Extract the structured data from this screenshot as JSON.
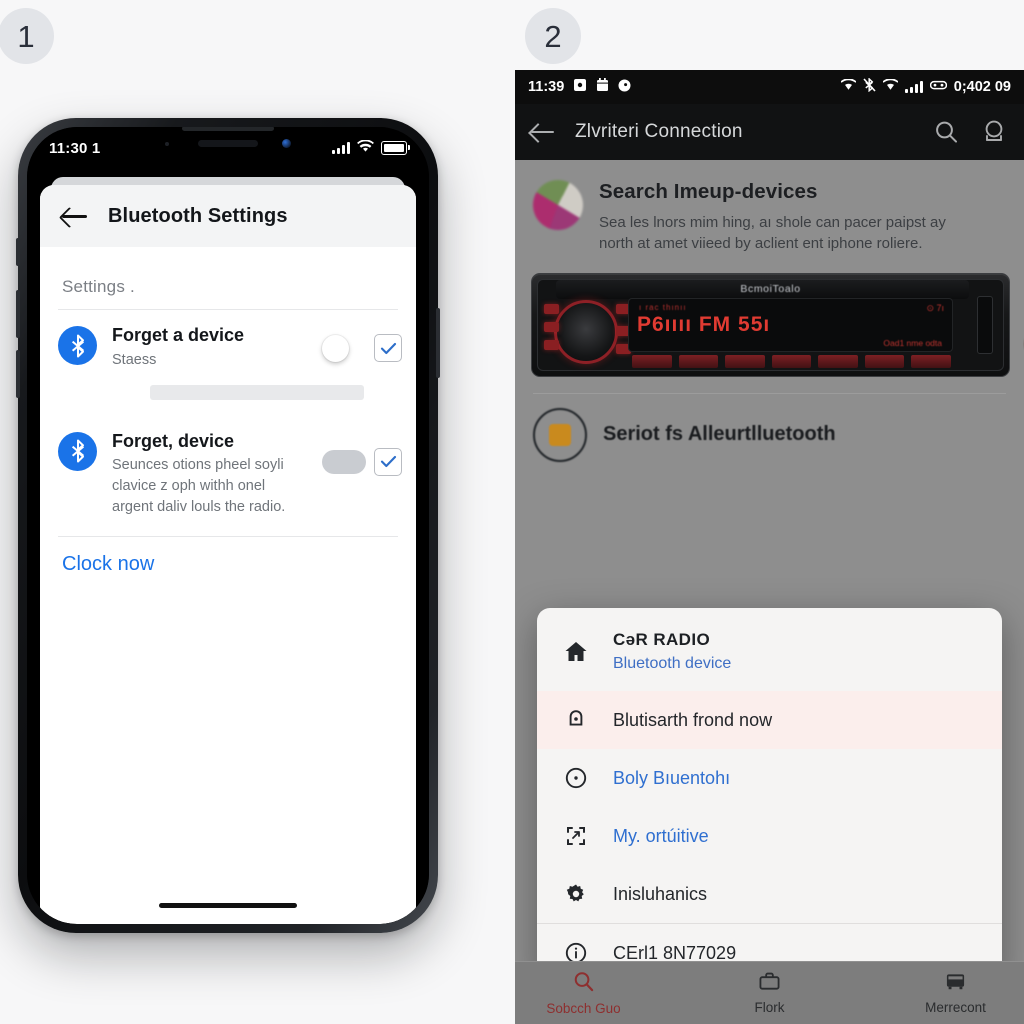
{
  "steps": {
    "one": "1",
    "two": "2"
  },
  "left_phone": {
    "status_bar": {
      "time": "11:30 1",
      "signal_icon": "signal-bars-icon",
      "wifi_icon": "wifi-icon",
      "battery_icon": "battery-icon"
    },
    "app_bar": {
      "back_icon": "back-arrow-icon",
      "title": "Bluetooth Settings"
    },
    "section_label": "Settings .",
    "rows": [
      {
        "icon": "bluetooth-icon",
        "title": "Forget a device",
        "subtitle": "Staess",
        "toggle_state": "off",
        "checkbox_state": "checked"
      },
      {
        "icon": "bluetooth-icon",
        "title": "Forget, device",
        "subtitle": "Seunces otions pheel soyli clavice z oph withh onel argent daliv louls the radio.",
        "toggle_state": "grey",
        "checkbox_state": "checked"
      }
    ],
    "link": "Clock now",
    "home_indicator": "home-indicator"
  },
  "right_phone": {
    "status_bar": {
      "time": "11:39",
      "left_icons": [
        "sim-icon",
        "calendar-icon",
        "record-icon"
      ],
      "right_icons": [
        "wifi-icon",
        "bluetooth-off-icon",
        "wifi-icon",
        "signal-bars-icon",
        "vr-icon"
      ],
      "right_text": "0;402 09"
    },
    "app_bar": {
      "back_icon": "back-arrow-icon",
      "title": "Zlvriteri Connection",
      "search_icon": "search-icon",
      "profile_icon": "account-icon"
    },
    "content": {
      "avatar_icon": "globe-avatar-icon",
      "heading": "Search Imeup-devices",
      "body": "Sea les lnors mim hing, aı shole can pacer paipst ay north at amet viieed by aclient ent iphone roliere.",
      "radio_image": {
        "brand": "BcmoiToalo",
        "lcd_line1": "ı rac  thınıı",
        "lcd_line2": "P6ıııı  FM 55ı",
        "lcd_line3": "Oad1 nme  odta",
        "lcd_line4": "⊙ 7ı",
        "avatar_icon": "user-avatar-icon"
      },
      "second_heading": "Seriot fs Alleurtlluetooth"
    },
    "sheet": {
      "items": [
        {
          "icon": "home-icon",
          "title": "CəR RADIO",
          "subtitle": "Bluetooth device",
          "type": "device"
        },
        {
          "icon": "bell-icon",
          "label": "Blutisarth frond now",
          "type": "plain",
          "highlighted": true
        },
        {
          "icon": "clock-icon",
          "label": "Boly Bıuentohı",
          "type": "link"
        },
        {
          "icon": "share-icon",
          "label": "My. ortúitive",
          "type": "link"
        },
        {
          "icon": "gear-icon",
          "label": "Inisluhanics",
          "type": "plain"
        },
        {
          "icon": "info-icon",
          "label": "CErl1 8N77029",
          "type": "plain",
          "separated": true
        }
      ]
    },
    "bottom_nav": [
      {
        "icon": "search-icon",
        "label": "Sobcch Guo",
        "active": true
      },
      {
        "icon": "briefcase-icon",
        "label": "Flork",
        "active": false
      },
      {
        "icon": "bus-icon",
        "label": "Merrecont",
        "active": false
      }
    ]
  },
  "colors": {
    "accent_blue": "#1a73e8",
    "link_blue": "#2f6fd0",
    "sheet_bg": "#f5f4f3",
    "highlight_row": "#fbeeec",
    "android_bg": "#8e8e8e",
    "status_black": "#0d0d0d",
    "nav_active": "#8e2f2f"
  }
}
